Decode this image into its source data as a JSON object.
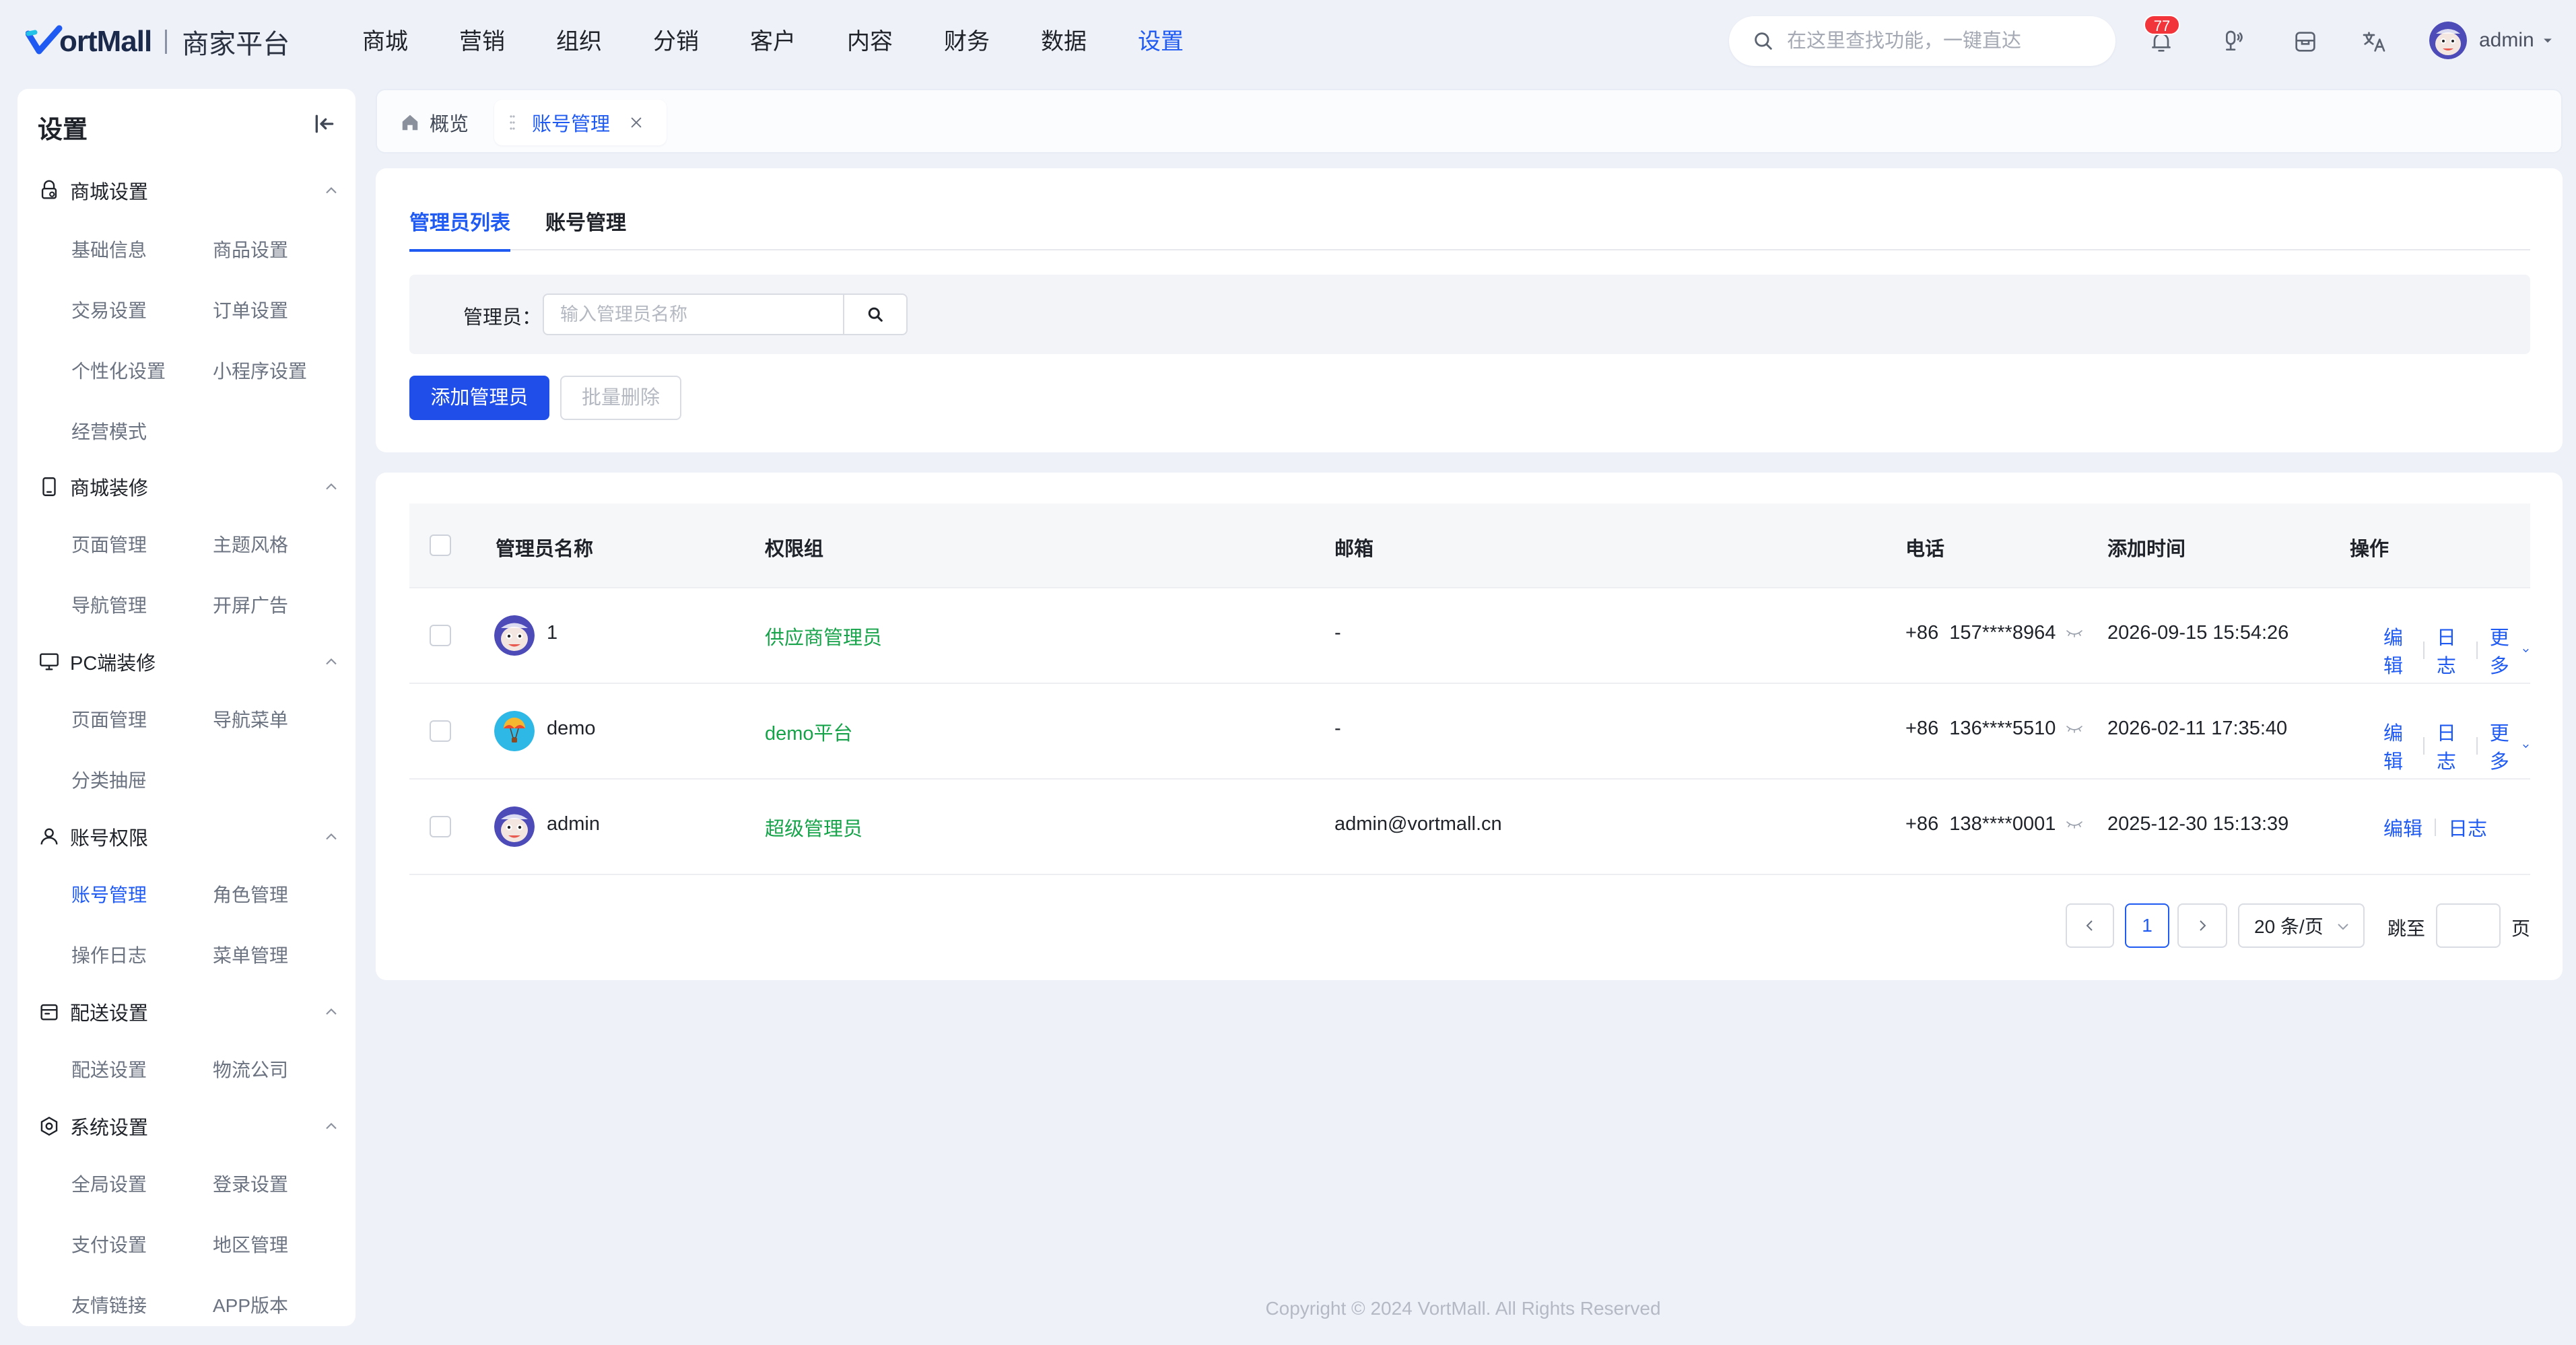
{
  "header": {
    "brand": "VortMall",
    "brand_visible": "ortMall",
    "subtitle": "商家平台",
    "nav": [
      "商城",
      "营销",
      "组织",
      "分销",
      "客户",
      "内容",
      "财务",
      "数据",
      "设置"
    ],
    "nav_active": "设置",
    "search_placeholder": "在这里查找功能，一键直达",
    "notifications_count": "77",
    "user_name": "admin",
    "icons": [
      "search-icon",
      "bell-icon",
      "microphone-icon",
      "store-icon",
      "translate-icon",
      "chevron-down-icon"
    ]
  },
  "sidebar": {
    "title": "设置",
    "groups": [
      {
        "label": "商城设置",
        "icon": "lock-shop-icon",
        "items": [
          "基础信息",
          "商品设置",
          "交易设置",
          "订单设置",
          "个性化设置",
          "小程序设置",
          "经营模式"
        ]
      },
      {
        "label": "商城装修",
        "icon": "tablet-icon",
        "items": [
          "页面管理",
          "主题风格",
          "导航管理",
          "开屏广告"
        ]
      },
      {
        "label": "PC端装修",
        "icon": "monitor-icon",
        "items": [
          "页面管理",
          "导航菜单",
          "分类抽屉"
        ]
      },
      {
        "label": "账号权限",
        "icon": "user-icon",
        "items": [
          "账号管理",
          "角色管理",
          "操作日志",
          "菜单管理"
        ]
      },
      {
        "label": "配送设置",
        "icon": "delivery-icon",
        "items": [
          "配送设置",
          "物流公司"
        ]
      },
      {
        "label": "系统设置",
        "icon": "system-gear-icon",
        "items": [
          "全局设置",
          "登录设置",
          "支付设置",
          "地区管理",
          "友情链接",
          "APP版本"
        ]
      }
    ],
    "active_item": "账号管理"
  },
  "page_tabs": {
    "home": "概览",
    "current": "账号管理"
  },
  "main": {
    "subtabs": [
      "管理员列表",
      "账号管理"
    ],
    "active_subtab": "管理员列表",
    "filter_label": "管理员：",
    "filter_placeholder": "输入管理员名称",
    "add_button": "添加管理员",
    "batch_delete_button": "批量删除"
  },
  "table": {
    "columns": [
      "管理员名称",
      "权限组",
      "邮箱",
      "电话",
      "添加时间",
      "操作"
    ],
    "rows": [
      {
        "name": "1",
        "group": "供应商管理员",
        "email": "-",
        "phone": "+86  157****8964",
        "time": "2026-09-15 15:54:26",
        "ops": [
          "编辑",
          "日志",
          "更多"
        ],
        "avatar": "cartoon-avatar"
      },
      {
        "name": "demo",
        "group": "demo平台",
        "email": "-",
        "phone": "+86  136****5510",
        "time": "2026-02-11 17:35:40",
        "ops": [
          "编辑",
          "日志",
          "更多"
        ],
        "avatar": "balloon-avatar"
      },
      {
        "name": "admin",
        "group": "超级管理员",
        "email": "admin@vortmall.cn",
        "phone": "+86  138****0001",
        "time": "2025-12-30 15:13:39",
        "ops": [
          "编辑",
          "日志"
        ],
        "avatar": "cartoon-avatar"
      }
    ]
  },
  "pagination": {
    "current_page": "1",
    "page_size": "20 条/页",
    "jump_label": "跳至",
    "page_suffix": "页"
  },
  "footer": "Copyright © 2024 VortMall. All Rights Reserved",
  "colors": {
    "accent": "#1f5af2",
    "primary_button": "#1f4fe8",
    "group_text": "#16a34a",
    "badge": "#f2353b",
    "background": "#eef1f8"
  }
}
